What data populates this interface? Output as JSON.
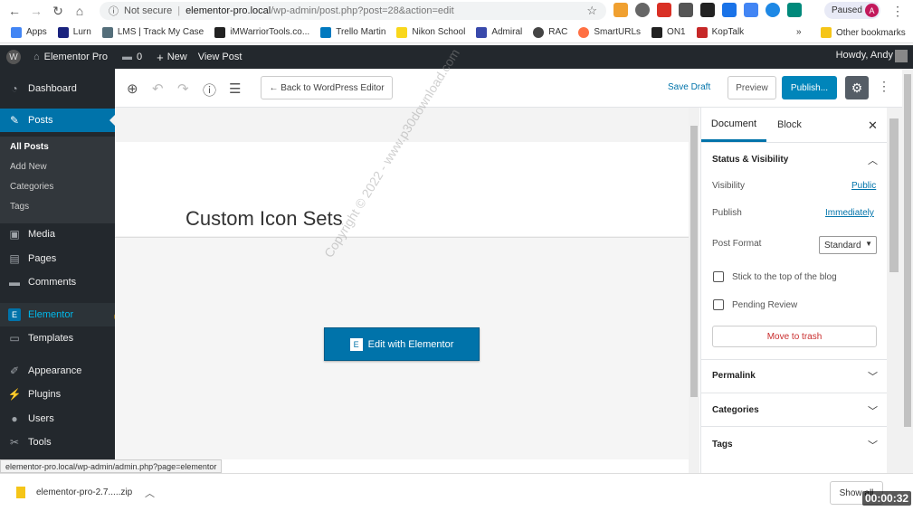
{
  "browser": {
    "url_security": "Not secure",
    "url_host": "elementor-pro.local",
    "url_path": "/wp-admin/post.php?post=28&action=edit",
    "profile_status": "Paused",
    "profile_initial": "A",
    "bookmarks": [
      "Apps",
      "Lurn",
      "LMS | Track My Case",
      "iMWarriorTools.co...",
      "Trello Martin",
      "Nikon School",
      "Admiral",
      "RAC",
      "SmartURLs",
      "ON1",
      "KopTalk"
    ],
    "bookmarks_overflow": "»",
    "other_bookmarks": "Other bookmarks"
  },
  "adminbar": {
    "site_name": "Elementor Pro",
    "comments_count": "0",
    "new_label": "New",
    "view_post": "View Post",
    "howdy": "Howdy, Andy"
  },
  "sidebar": {
    "dashboard": "Dashboard",
    "posts": "Posts",
    "sub": [
      "All Posts",
      "Add New",
      "Categories",
      "Tags"
    ],
    "media": "Media",
    "pages": "Pages",
    "comments": "Comments",
    "elementor": "Elementor",
    "templates": "Templates",
    "appearance": "Appearance",
    "plugins": "Plugins",
    "users": "Users",
    "tools": "Tools"
  },
  "toolbar": {
    "back_label": "← Back to WordPress Editor",
    "save_draft": "Save Draft",
    "preview": "Preview",
    "publish": "Publish..."
  },
  "content": {
    "post_title": "Custom Icon Sets",
    "edit_button": "Edit with Elementor",
    "watermark": "Copyright © 2022 - www.p30download.com"
  },
  "panel": {
    "tab_document": "Document",
    "tab_block": "Block",
    "status_visibility": "Status & Visibility",
    "visibility_label": "Visibility",
    "visibility_value": "Public",
    "publish_label": "Publish",
    "publish_value": "Immediately",
    "post_format_label": "Post Format",
    "post_format_value": "Standard",
    "sticky_label": "Stick to the top of the blog",
    "pending_label": "Pending Review",
    "trash_label": "Move to trash",
    "permalink": "Permalink",
    "categories": "Categories",
    "tags": "Tags"
  },
  "status_url": "elementor-pro.local/wp-admin/admin.php?page=elementor",
  "downloads": {
    "file_name": "elementor-pro-2.7.....zip",
    "show_all": "Show all"
  },
  "timer": "00:00:32"
}
